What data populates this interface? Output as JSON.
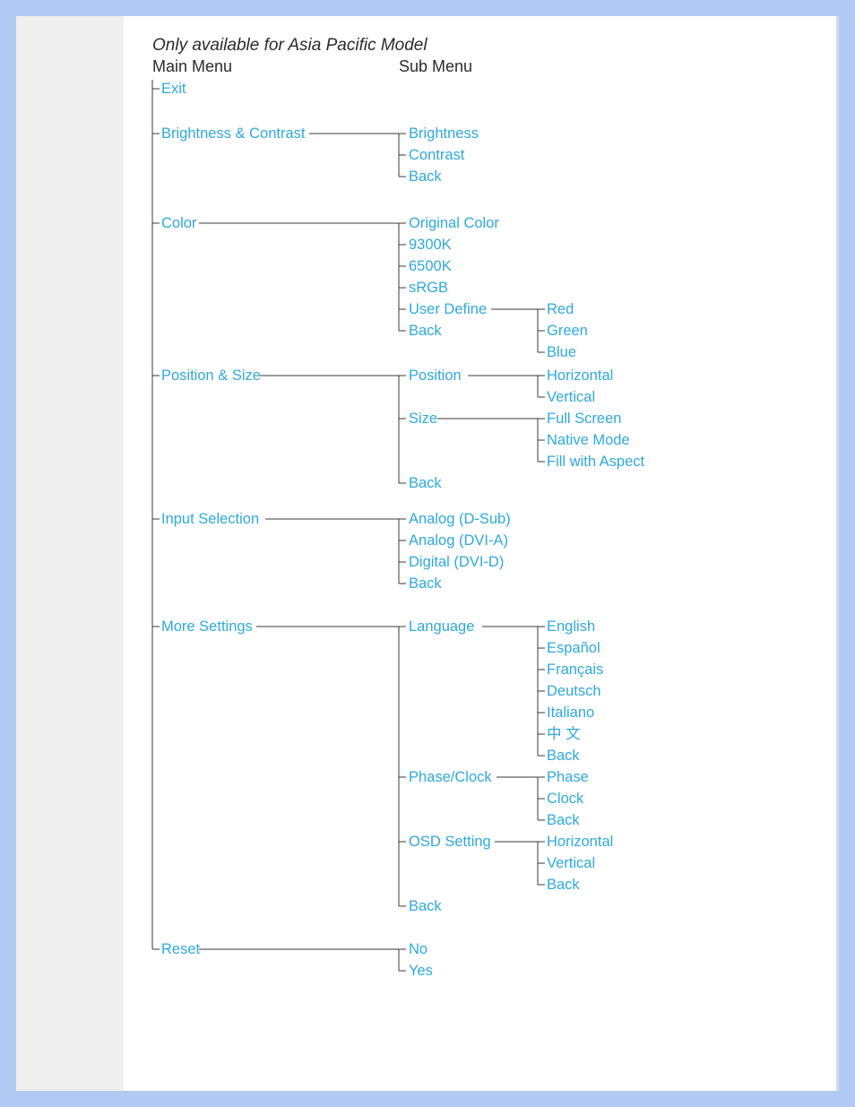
{
  "note": "Only available for Asia Pacific Model",
  "headers": {
    "main": "Main Menu",
    "sub": "Sub Menu"
  },
  "main": {
    "exit": "Exit",
    "brightness_contrast": "Brightness & Contrast",
    "color": "Color",
    "position_size": "Position & Size",
    "input_selection": "Input Selection",
    "more_settings": "More Settings",
    "reset": "Reset"
  },
  "brightness_contrast": {
    "brightness": "Brightness",
    "contrast": "Contrast",
    "back": "Back"
  },
  "color": {
    "original": "Original Color",
    "k9300": "9300K",
    "k6500": "6500K",
    "srgb": "sRGB",
    "user_define": "User Define",
    "back": "Back",
    "rgb": {
      "red": "Red",
      "green": "Green",
      "blue": "Blue"
    }
  },
  "position_size": {
    "position": "Position",
    "size": "Size",
    "back": "Back",
    "position_sub": {
      "horizontal": "Horizontal",
      "vertical": "Vertical"
    },
    "size_sub": {
      "full_screen": "Full Screen",
      "native_mode": "Native Mode",
      "fill_aspect": "Fill with Aspect"
    }
  },
  "input_selection": {
    "analog_dsub": "Analog (D-Sub)",
    "analog_dvia": "Analog (DVI-A)",
    "digital_dvid": "Digital (DVI-D)",
    "back": "Back"
  },
  "more_settings": {
    "language": "Language",
    "phase_clock": "Phase/Clock",
    "osd_setting": "OSD Setting",
    "back": "Back",
    "language_sub": {
      "english": "English",
      "espanol": "Español",
      "francais": "Français",
      "deutsch": "Deutsch",
      "italiano": "Italiano",
      "chinese": "中 文",
      "back": "Back"
    },
    "phase_clock_sub": {
      "phase": "Phase",
      "clock": "Clock",
      "back": "Back"
    },
    "osd_setting_sub": {
      "horizontal": "Horizontal",
      "vertical": "Vertical",
      "back": "Back"
    }
  },
  "reset": {
    "no": "No",
    "yes": "Yes"
  }
}
